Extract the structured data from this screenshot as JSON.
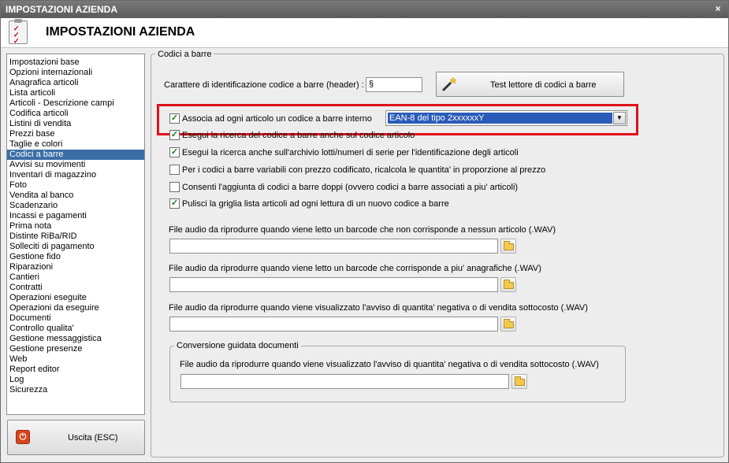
{
  "window": {
    "title": "IMPOSTAZIONI AZIENDA",
    "close_symbol": "×"
  },
  "header": {
    "title": "IMPOSTAZIONI AZIENDA",
    "icon": "checklist-icon"
  },
  "sidebar": {
    "items": [
      {
        "label": "Impostazioni base"
      },
      {
        "label": "Opzioni internazionali"
      },
      {
        "label": "Anagrafica articoli"
      },
      {
        "label": "Lista articoli"
      },
      {
        "label": "Articoli - Descrizione campi"
      },
      {
        "label": "Codifica articoli"
      },
      {
        "label": "Listini di vendita"
      },
      {
        "label": "Prezzi base"
      },
      {
        "label": "Taglie e colori"
      },
      {
        "label": "Codici a barre",
        "selected": true
      },
      {
        "label": "Avvisi su movimenti"
      },
      {
        "label": "Inventari di magazzino"
      },
      {
        "label": "Foto"
      },
      {
        "label": "Vendita al banco"
      },
      {
        "label": "Scadenzario"
      },
      {
        "label": "Incassi e pagamenti"
      },
      {
        "label": "Prima nota"
      },
      {
        "label": "Distinte RiBa/RID"
      },
      {
        "label": "Solleciti di pagamento"
      },
      {
        "label": "Gestione fido"
      },
      {
        "label": "Riparazioni"
      },
      {
        "label": "Cantieri"
      },
      {
        "label": "Contratti"
      },
      {
        "label": "Operazioni eseguite"
      },
      {
        "label": "Operazioni da eseguire"
      },
      {
        "label": "Documenti"
      },
      {
        "label": "Controllo qualita'"
      },
      {
        "label": "Gestione messaggistica"
      },
      {
        "label": "Gestione presenze"
      },
      {
        "label": "Web"
      },
      {
        "label": "Report editor"
      },
      {
        "label": "Log"
      },
      {
        "label": "Sicurezza"
      }
    ]
  },
  "exit_button": {
    "label": "Uscita (ESC)",
    "icon": "power-icon"
  },
  "panel": {
    "legend": "Codici a barre",
    "header_char_label": "Carattere di identificazione codice a barre (header) :",
    "header_char_value": "§",
    "test_button_label": "Test lettore di codici a barre",
    "test_button_icon": "magic-wand-icon",
    "associa": {
      "label": "Associa ad ogni articolo un codice a barre interno",
      "checked": true,
      "combo_value": "EAN-8 del tipo 2xxxxxxY"
    },
    "checkboxes": [
      {
        "label": "Esegui la ricerca del codice a barre anche sul codice articolo",
        "checked": true
      },
      {
        "label": "Esegui la ricerca anche sull'archivio lotti/numeri di serie per l'identificazione degli articoli",
        "checked": true
      },
      {
        "label": "Per i codici a barre variabili con prezzo codificato, ricalcola le quantita' in proporzione al prezzo",
        "checked": false
      },
      {
        "label": "Consenti l'aggiunta di codici a barre doppi (ovvero codici a barre associati a piu' articoli)",
        "checked": false
      },
      {
        "label": "Pulisci la griglia lista articoli ad ogni lettura di un nuovo codice a barre",
        "checked": true
      }
    ],
    "audio_fields": [
      {
        "label": "File audio da riprodurre quando viene letto un barcode che non corrisponde a nessun articolo (.WAV)",
        "value": ""
      },
      {
        "label": "File audio da riprodurre quando viene letto un barcode che corrisponde a piu' anagrafiche (.WAV)",
        "value": ""
      },
      {
        "label": "File audio da riprodurre quando viene visualizzato l'avviso di quantita' negativa o di vendita sottocosto (.WAV)",
        "value": ""
      }
    ],
    "conversione": {
      "legend": "Conversione guidata documenti",
      "label": "File audio da riprodurre quando viene visualizzato l'avviso di quantita' negativa o di vendita sottocosto (.WAV)",
      "value": ""
    }
  },
  "colors": {
    "selection": "#3a6ea5",
    "highlight_border": "#e0101a",
    "combo_selection": "#2a5bb8"
  }
}
